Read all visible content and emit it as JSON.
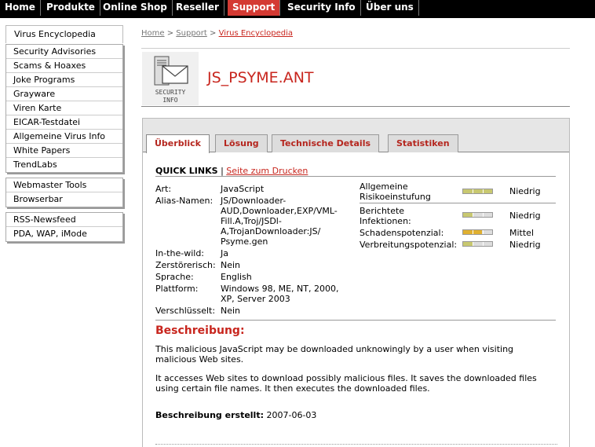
{
  "topnav": {
    "items": [
      "Home",
      "Produkte",
      "Online Shop",
      "Reseller",
      "Support",
      "Security Info",
      "Über uns"
    ],
    "active": "Support"
  },
  "sidebar": {
    "top_item": "Virus Encyclopedia",
    "group1": [
      "Security Advisories",
      "Scams & Hoaxes",
      "Joke Programs",
      "Grayware",
      "Viren Karte",
      "EICAR-Testdatei",
      "Allgemeine Virus Info",
      "White Papers",
      "TrendLabs"
    ],
    "group2": [
      "Webmaster Tools",
      "Browserbar"
    ],
    "group3": [
      "RSS-Newsfeed",
      "PDA, WAP, iMode"
    ]
  },
  "breadcrumb": {
    "home": "Home",
    "support": "Support",
    "current": "Virus Encyclopedia",
    "sep": ">"
  },
  "icon": {
    "line1": "SECURITY",
    "line2": "INFO"
  },
  "title": "JS_PSYME.ANT",
  "tabs": [
    "Überblick",
    "Lösung",
    "Technische Details",
    "Statistiken"
  ],
  "quicklinks": {
    "label": "QUICK LINKS",
    "sep": "|",
    "print_link": "Seite zum Drucken"
  },
  "details": {
    "art_label": "Art:",
    "art": "JavaScript",
    "alias_label": "Alias-Namen:",
    "alias_lines": [
      "JS/Downloader-",
      "AUD,Downloader,EXP/VML-",
      "Fill.A,Troj/JSDl-",
      "A,TrojanDownloader:JS/",
      "Psyme.gen"
    ],
    "wild_label": "In-the-wild:",
    "wild": "Ja",
    "destr_label": "Zerstörerisch:",
    "destr": "Nein",
    "lang_label": "Sprache:",
    "lang": "English",
    "platform_label": "Plattform:",
    "platform_lines": [
      "Windows 98, ME, NT, 2000,",
      "XP, Server 2003"
    ],
    "enc_label": "Verschlüsselt:",
    "enc": "Nein"
  },
  "risk": [
    {
      "label_lines": [
        "Allgemeine",
        "Risikoeinstufung"
      ],
      "value": "Niedrig",
      "level": 1.0,
      "color": "#c8c870"
    },
    {
      "label_lines": [
        "Berichtete",
        "Infektionen:"
      ],
      "value": "Niedrig",
      "level": 0.33,
      "color": "#c8c870"
    },
    {
      "label_lines": [
        "Schadenspotenzial:"
      ],
      "value": "Mittel",
      "level": 0.66,
      "color": "#e0b030"
    },
    {
      "label_lines": [
        "Verbreitungspotenzial:"
      ],
      "value": "Niedrig",
      "level": 0.33,
      "color": "#c8c870"
    }
  ],
  "description": {
    "heading": "Beschreibung:",
    "p1_lines": [
      "This malicious JavaScript may be downloaded unknowingly by a user when visiting",
      "malicious Web sites."
    ],
    "p2_lines": [
      "It accesses Web sites to download possibly malicious files. It saves the downloaded files",
      "using certain file names. It then executes the downloaded files."
    ],
    "created_label": "Beschreibung erstellt:",
    "created_date": "2007-06-03"
  },
  "colors": {
    "accent": "#c8261e",
    "nav_bg": "#000000",
    "nav_active": "#d43a33"
  }
}
